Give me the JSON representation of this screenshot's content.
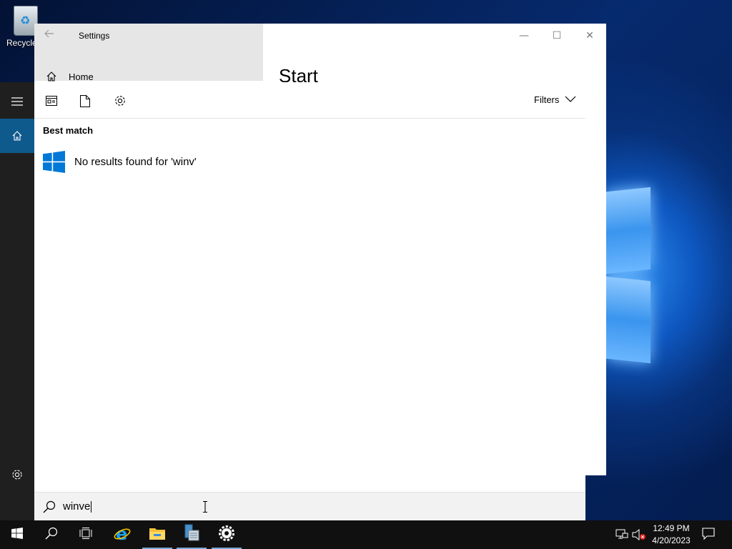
{
  "desktop": {
    "recycle_bin_label": "Recycle"
  },
  "settings_window": {
    "title": "Settings",
    "home_label": "Home",
    "heading": "Start",
    "back_icon": "back-arrow-icon",
    "controls": {
      "minimize_glyph": "—",
      "maximize_glyph": "☐",
      "close_glyph": "✕"
    }
  },
  "start_rail": {
    "items": [
      "hamburger-icon",
      "home-icon",
      "gear-icon"
    ]
  },
  "search_panel": {
    "toolbar": {
      "icons": [
        "apps-icon",
        "documents-icon",
        "settings-icon"
      ],
      "filters_label": "Filters"
    },
    "section_title": "Best match",
    "result_text": "No results found for 'winv'",
    "accent_color": "#0078d7"
  },
  "search_box": {
    "query": "winve"
  },
  "taskbar": {
    "buttons": [
      "start-icon",
      "search-icon",
      "task-view-icon",
      "internet-explorer-icon",
      "file-explorer-icon",
      "server-manager-icon",
      "settings-app-icon"
    ],
    "clock": {
      "time": "12:49 PM",
      "date": "4/20/2023"
    }
  }
}
